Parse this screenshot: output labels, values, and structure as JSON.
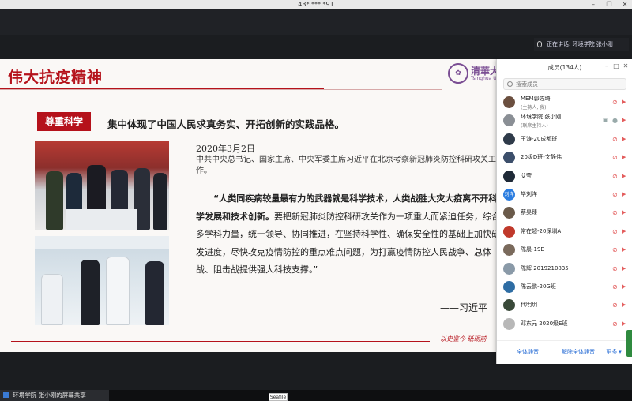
{
  "window": {
    "title": "43* *** *91"
  },
  "speaker": {
    "label": "正在讲话: 环境学院 张小刚"
  },
  "slide": {
    "title": "伟大抗疫精神",
    "logo_text": "清華大",
    "logo_sub": "Tsinghua Uni",
    "tag": "尊重科学",
    "caption": "集中体现了中国人民求真务实、开拓创新的实践品格。",
    "date": "2020年3月2日",
    "news": "中共中央总书记、国家主席、中央军委主席习近平在北京考察新冠肺炎防控科研攻关工作。",
    "quote_bold": "“人类同疾病较量最有力的武器就是科学技术，人类战胜大灾大疫离不开科学发展和技术创新。",
    "quote_rest": "要把新冠肺炎防控科研攻关作为一项重大而紧迫任务，综合多学科力量，统一领导、协同推进，在坚持科学性、确保安全性的基础上加快研发进度，尽快攻克疫情防控的重点难点问题，为打赢疫情防控人民战争、总体战、阻击战提供强大科技支撑。”",
    "author": "——习近平",
    "motto": "以史鉴今  砥砺前"
  },
  "panel": {
    "title": "成员(134人)",
    "search_placeholder": "搜索成员",
    "members": [
      {
        "name": "MEM郭佐琦",
        "role": "(主持人, 我)",
        "avatar_color": "#6b4f3f",
        "avatar_text": ""
      },
      {
        "name": "环境学院 张小刚",
        "role": "(联席主持人)",
        "avatar_color": "#8a8f95",
        "avatar_text": ""
      },
      {
        "name": "王涛-20成都班",
        "role": "",
        "avatar_color": "#2f3b4a",
        "avatar_text": ""
      },
      {
        "name": "20级D班-文静伟",
        "role": "",
        "avatar_color": "#3c4f6b",
        "avatar_text": ""
      },
      {
        "name": "艾莹",
        "role": "",
        "avatar_color": "#1f2a38",
        "avatar_text": ""
      },
      {
        "name": "毕刘洋",
        "role": "",
        "avatar_color": "#2b7de0",
        "avatar_text": "刘洋"
      },
      {
        "name": "蔡昊臻",
        "role": "",
        "avatar_color": "#6a5a4a",
        "avatar_text": ""
      },
      {
        "name": "常在超-20深圳A",
        "role": "",
        "avatar_color": "#c0392b",
        "avatar_text": ""
      },
      {
        "name": "陈晨-19E",
        "role": "",
        "avatar_color": "#7a6a5c",
        "avatar_text": ""
      },
      {
        "name": "陈辉 2019210835",
        "role": "",
        "avatar_color": "#8a9aa8",
        "avatar_text": ""
      },
      {
        "name": "陈云鹏-20G班",
        "role": "",
        "avatar_color": "#2e6da4",
        "avatar_text": ""
      },
      {
        "name": "代明玥",
        "role": "",
        "avatar_color": "#3a4a3a",
        "avatar_text": ""
      },
      {
        "name": "邓东元 2020级E班",
        "role": "",
        "avatar_color": "#b8b8b8",
        "avatar_text": ""
      }
    ],
    "mute_all": "全体静音",
    "unmute_all": "解除全体静音",
    "more": "更多 ▾"
  },
  "bottom": {
    "share_text": "环境学院 张小刚的屏幕共享",
    "seafile": "Seafile"
  },
  "colors": {
    "accent": "#b5121b",
    "link": "#2b6fd6",
    "mute": "#e35b5b"
  }
}
